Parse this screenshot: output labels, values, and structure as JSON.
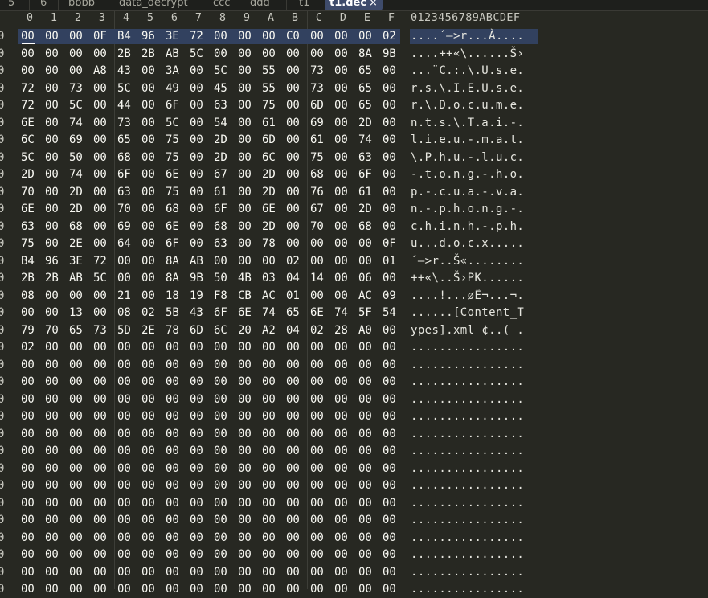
{
  "tabs": [
    {
      "label": "5",
      "active": false
    },
    {
      "label": "6",
      "active": false
    },
    {
      "label": "bbbb",
      "active": false
    },
    {
      "label": "data_decrypt",
      "active": false
    },
    {
      "label": "ccc",
      "active": false
    },
    {
      "label": "ddd",
      "active": false
    },
    {
      "label": "t1",
      "active": false
    },
    {
      "label": "t1.dec",
      "active": true,
      "close": "×"
    }
  ],
  "column_headers": [
    "0",
    "1",
    "2",
    "3",
    "4",
    "5",
    "6",
    "7",
    "8",
    "9",
    "A",
    "B",
    "C",
    "D",
    "E",
    "F"
  ],
  "ascii_header": "0123456789ABCDEF",
  "row_offset_digit": "0",
  "rows": [
    {
      "hex": [
        "00",
        "00",
        "00",
        "0F",
        "B4",
        "96",
        "3E",
        "72",
        "00",
        "00",
        "00",
        "C0",
        "00",
        "00",
        "00",
        "02"
      ],
      "ascii": "....´–>r...À...."
    },
    {
      "hex": [
        "00",
        "00",
        "00",
        "00",
        "2B",
        "2B",
        "AB",
        "5C",
        "00",
        "00",
        "00",
        "00",
        "00",
        "00",
        "8A",
        "9B"
      ],
      "ascii": "....++«\\......Š›"
    },
    {
      "hex": [
        "00",
        "00",
        "00",
        "A8",
        "43",
        "00",
        "3A",
        "00",
        "5C",
        "00",
        "55",
        "00",
        "73",
        "00",
        "65",
        "00"
      ],
      "ascii": "...¨C.:.\\.U.s.e."
    },
    {
      "hex": [
        "72",
        "00",
        "73",
        "00",
        "5C",
        "00",
        "49",
        "00",
        "45",
        "00",
        "55",
        "00",
        "73",
        "00",
        "65",
        "00"
      ],
      "ascii": "r.s.\\.I.E.U.s.e."
    },
    {
      "hex": [
        "72",
        "00",
        "5C",
        "00",
        "44",
        "00",
        "6F",
        "00",
        "63",
        "00",
        "75",
        "00",
        "6D",
        "00",
        "65",
        "00"
      ],
      "ascii": "r.\\.D.o.c.u.m.e."
    },
    {
      "hex": [
        "6E",
        "00",
        "74",
        "00",
        "73",
        "00",
        "5C",
        "00",
        "54",
        "00",
        "61",
        "00",
        "69",
        "00",
        "2D",
        "00"
      ],
      "ascii": "n.t.s.\\.T.a.i.-."
    },
    {
      "hex": [
        "6C",
        "00",
        "69",
        "00",
        "65",
        "00",
        "75",
        "00",
        "2D",
        "00",
        "6D",
        "00",
        "61",
        "00",
        "74",
        "00"
      ],
      "ascii": "l.i.e.u.-.m.a.t."
    },
    {
      "hex": [
        "5C",
        "00",
        "50",
        "00",
        "68",
        "00",
        "75",
        "00",
        "2D",
        "00",
        "6C",
        "00",
        "75",
        "00",
        "63",
        "00"
      ],
      "ascii": "\\.P.h.u.-.l.u.c."
    },
    {
      "hex": [
        "2D",
        "00",
        "74",
        "00",
        "6F",
        "00",
        "6E",
        "00",
        "67",
        "00",
        "2D",
        "00",
        "68",
        "00",
        "6F",
        "00"
      ],
      "ascii": "-.t.o.n.g.-.h.o."
    },
    {
      "hex": [
        "70",
        "00",
        "2D",
        "00",
        "63",
        "00",
        "75",
        "00",
        "61",
        "00",
        "2D",
        "00",
        "76",
        "00",
        "61",
        "00"
      ],
      "ascii": "p.-.c.u.a.-.v.a."
    },
    {
      "hex": [
        "6E",
        "00",
        "2D",
        "00",
        "70",
        "00",
        "68",
        "00",
        "6F",
        "00",
        "6E",
        "00",
        "67",
        "00",
        "2D",
        "00"
      ],
      "ascii": "n.-.p.h.o.n.g.-."
    },
    {
      "hex": [
        "63",
        "00",
        "68",
        "00",
        "69",
        "00",
        "6E",
        "00",
        "68",
        "00",
        "2D",
        "00",
        "70",
        "00",
        "68",
        "00"
      ],
      "ascii": "c.h.i.n.h.-.p.h."
    },
    {
      "hex": [
        "75",
        "00",
        "2E",
        "00",
        "64",
        "00",
        "6F",
        "00",
        "63",
        "00",
        "78",
        "00",
        "00",
        "00",
        "00",
        "0F"
      ],
      "ascii": "u...d.o.c.x....."
    },
    {
      "hex": [
        "B4",
        "96",
        "3E",
        "72",
        "00",
        "00",
        "8A",
        "AB",
        "00",
        "00",
        "00",
        "02",
        "00",
        "00",
        "00",
        "01"
      ],
      "ascii": "´–>r..Š«........"
    },
    {
      "hex": [
        "2B",
        "2B",
        "AB",
        "5C",
        "00",
        "00",
        "8A",
        "9B",
        "50",
        "4B",
        "03",
        "04",
        "14",
        "00",
        "06",
        "00"
      ],
      "ascii": "++«\\..Š›PK......"
    },
    {
      "hex": [
        "08",
        "00",
        "00",
        "00",
        "21",
        "00",
        "18",
        "19",
        "F8",
        "CB",
        "AC",
        "01",
        "00",
        "00",
        "AC",
        "09"
      ],
      "ascii": "....!...øË¬...¬."
    },
    {
      "hex": [
        "00",
        "00",
        "13",
        "00",
        "08",
        "02",
        "5B",
        "43",
        "6F",
        "6E",
        "74",
        "65",
        "6E",
        "74",
        "5F",
        "54"
      ],
      "ascii": "......[Content_T"
    },
    {
      "hex": [
        "79",
        "70",
        "65",
        "73",
        "5D",
        "2E",
        "78",
        "6D",
        "6C",
        "20",
        "A2",
        "04",
        "02",
        "28",
        "A0",
        "00"
      ],
      "ascii": "ypes].xml ¢..( ."
    },
    {
      "hex": [
        "02",
        "00",
        "00",
        "00",
        "00",
        "00",
        "00",
        "00",
        "00",
        "00",
        "00",
        "00",
        "00",
        "00",
        "00",
        "00"
      ],
      "ascii": "................"
    },
    {
      "hex": [
        "00",
        "00",
        "00",
        "00",
        "00",
        "00",
        "00",
        "00",
        "00",
        "00",
        "00",
        "00",
        "00",
        "00",
        "00",
        "00"
      ],
      "ascii": "................"
    },
    {
      "hex": [
        "00",
        "00",
        "00",
        "00",
        "00",
        "00",
        "00",
        "00",
        "00",
        "00",
        "00",
        "00",
        "00",
        "00",
        "00",
        "00"
      ],
      "ascii": "................"
    },
    {
      "hex": [
        "00",
        "00",
        "00",
        "00",
        "00",
        "00",
        "00",
        "00",
        "00",
        "00",
        "00",
        "00",
        "00",
        "00",
        "00",
        "00"
      ],
      "ascii": "................"
    },
    {
      "hex": [
        "00",
        "00",
        "00",
        "00",
        "00",
        "00",
        "00",
        "00",
        "00",
        "00",
        "00",
        "00",
        "00",
        "00",
        "00",
        "00"
      ],
      "ascii": "................"
    },
    {
      "hex": [
        "00",
        "00",
        "00",
        "00",
        "00",
        "00",
        "00",
        "00",
        "00",
        "00",
        "00",
        "00",
        "00",
        "00",
        "00",
        "00"
      ],
      "ascii": "................"
    },
    {
      "hex": [
        "00",
        "00",
        "00",
        "00",
        "00",
        "00",
        "00",
        "00",
        "00",
        "00",
        "00",
        "00",
        "00",
        "00",
        "00",
        "00"
      ],
      "ascii": "................"
    },
    {
      "hex": [
        "00",
        "00",
        "00",
        "00",
        "00",
        "00",
        "00",
        "00",
        "00",
        "00",
        "00",
        "00",
        "00",
        "00",
        "00",
        "00"
      ],
      "ascii": "................"
    },
    {
      "hex": [
        "00",
        "00",
        "00",
        "00",
        "00",
        "00",
        "00",
        "00",
        "00",
        "00",
        "00",
        "00",
        "00",
        "00",
        "00",
        "00"
      ],
      "ascii": "................"
    },
    {
      "hex": [
        "00",
        "00",
        "00",
        "00",
        "00",
        "00",
        "00",
        "00",
        "00",
        "00",
        "00",
        "00",
        "00",
        "00",
        "00",
        "00"
      ],
      "ascii": "................"
    },
    {
      "hex": [
        "00",
        "00",
        "00",
        "00",
        "00",
        "00",
        "00",
        "00",
        "00",
        "00",
        "00",
        "00",
        "00",
        "00",
        "00",
        "00"
      ],
      "ascii": "................"
    },
    {
      "hex": [
        "00",
        "00",
        "00",
        "00",
        "00",
        "00",
        "00",
        "00",
        "00",
        "00",
        "00",
        "00",
        "00",
        "00",
        "00",
        "00"
      ],
      "ascii": "................"
    },
    {
      "hex": [
        "00",
        "00",
        "00",
        "00",
        "00",
        "00",
        "00",
        "00",
        "00",
        "00",
        "00",
        "00",
        "00",
        "00",
        "00",
        "00"
      ],
      "ascii": "................"
    },
    {
      "hex": [
        "00",
        "00",
        "00",
        "00",
        "00",
        "00",
        "00",
        "00",
        "00",
        "00",
        "00",
        "00",
        "00",
        "00",
        "00",
        "00"
      ],
      "ascii": "................"
    },
    {
      "hex": [
        "00",
        "00",
        "00",
        "00",
        "00",
        "00",
        "00",
        "00",
        "00",
        "00",
        "00",
        "00",
        "00",
        "00",
        "00",
        "00"
      ],
      "ascii": "................"
    }
  ],
  "colors": {
    "background": "#272822",
    "selection": "#32415f",
    "active_tab": "#3e4b6b"
  }
}
